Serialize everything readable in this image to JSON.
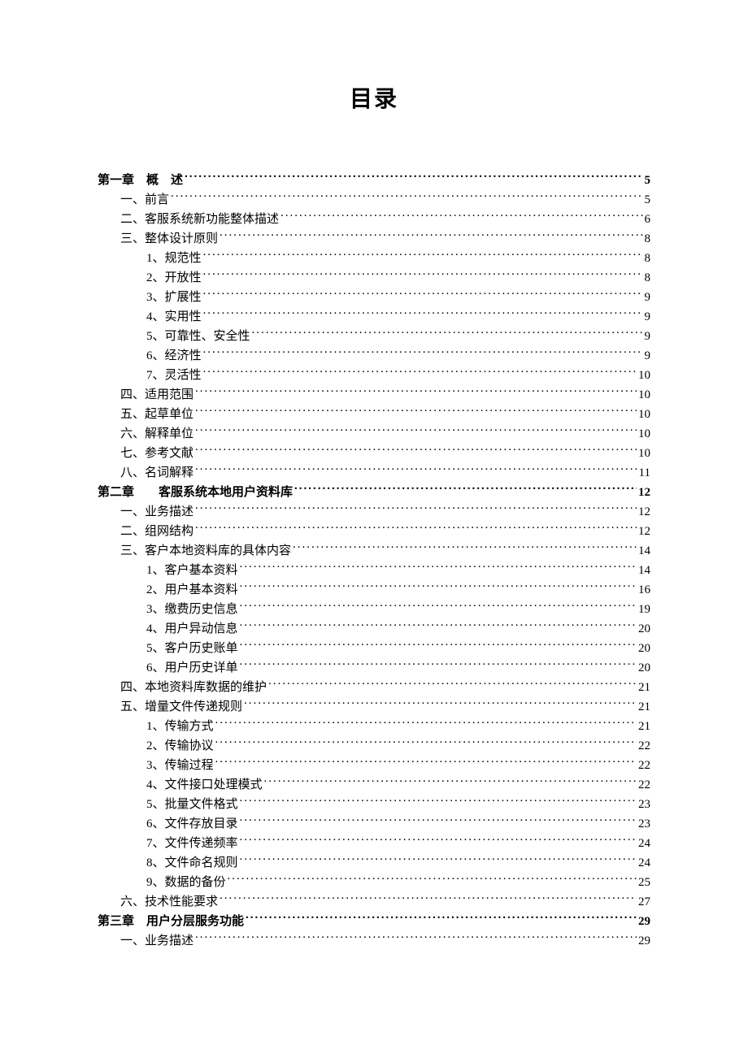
{
  "title": "目录",
  "toc": [
    {
      "level": 0,
      "label": "第一章　概　述",
      "page": "5"
    },
    {
      "level": 1,
      "label": "一、前言",
      "page": "5"
    },
    {
      "level": 1,
      "label": "二、客服系统新功能整体描述",
      "page": "6"
    },
    {
      "level": 1,
      "label": "三、整体设计原则",
      "page": "8"
    },
    {
      "level": 2,
      "label": "1、规范性",
      "page": "8"
    },
    {
      "level": 2,
      "label": "2、开放性",
      "page": "8"
    },
    {
      "level": 2,
      "label": "3、扩展性",
      "page": "9"
    },
    {
      "level": 2,
      "label": "4、实用性",
      "page": "9"
    },
    {
      "level": 2,
      "label": "5、可靠性、安全性",
      "page": "9"
    },
    {
      "level": 2,
      "label": "6、经济性",
      "page": "9"
    },
    {
      "level": 2,
      "label": "7、灵活性",
      "page": "10"
    },
    {
      "level": 1,
      "label": "四、适用范围",
      "page": "10"
    },
    {
      "level": 1,
      "label": "五、起草单位",
      "page": "10"
    },
    {
      "level": 1,
      "label": "六、解释单位",
      "page": "10"
    },
    {
      "level": 1,
      "label": "七、参考文献",
      "page": "10"
    },
    {
      "level": 1,
      "label": "八、名词解释",
      "page": "11"
    },
    {
      "level": 0,
      "label": "第二章　　客服系统本地用户资料库",
      "page": "12"
    },
    {
      "level": 1,
      "label": "一、业务描述",
      "page": "12"
    },
    {
      "level": 1,
      "label": "二、组网结构",
      "page": "12"
    },
    {
      "level": 1,
      "label": "三、客户本地资料库的具体内容",
      "page": "14"
    },
    {
      "level": 2,
      "label": "1、客户基本资料",
      "page": "14"
    },
    {
      "level": 2,
      "label": "2、用户基本资料",
      "page": "16"
    },
    {
      "level": 2,
      "label": "3、缴费历史信息",
      "page": "19"
    },
    {
      "level": 2,
      "label": "4、用户异动信息",
      "page": "20"
    },
    {
      "level": 2,
      "label": "5、客户历史账单",
      "page": "20"
    },
    {
      "level": 2,
      "label": "6、用户历史详单",
      "page": "20"
    },
    {
      "level": 1,
      "label": "四、本地资料库数据的维护",
      "page": "21"
    },
    {
      "level": 1,
      "label": "五、增量文件传递规则",
      "page": "21"
    },
    {
      "level": 2,
      "label": "1、传输方式",
      "page": "21"
    },
    {
      "level": 2,
      "label": "2、传输协议",
      "page": "22"
    },
    {
      "level": 2,
      "label": "3、传输过程",
      "page": "22"
    },
    {
      "level": 2,
      "label": "4、文件接口处理模式",
      "page": "22"
    },
    {
      "level": 2,
      "label": "5、批量文件格式",
      "page": "23"
    },
    {
      "level": 2,
      "label": "6、文件存放目录",
      "page": "23"
    },
    {
      "level": 2,
      "label": "7、文件传递频率",
      "page": "24"
    },
    {
      "level": 2,
      "label": "8、文件命名规则",
      "page": "24"
    },
    {
      "level": 2,
      "label": "9、数据的备份",
      "page": "25"
    },
    {
      "level": 1,
      "label": "六、技术性能要求",
      "page": "27"
    },
    {
      "level": 0,
      "label": "第三章　用户分层服务功能",
      "page": "29"
    },
    {
      "level": 1,
      "label": "一、业务描述",
      "page": "29"
    }
  ]
}
